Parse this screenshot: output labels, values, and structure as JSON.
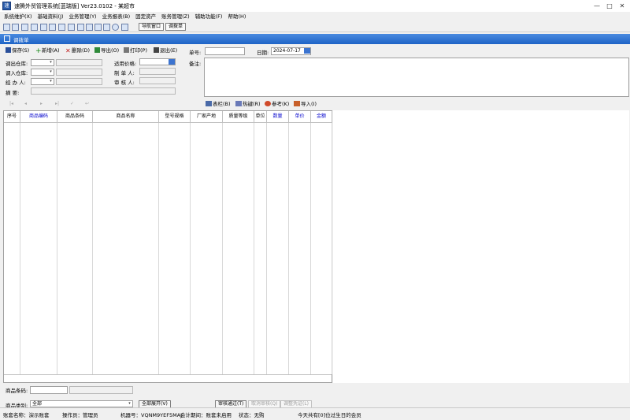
{
  "window": {
    "title": "速腾外贸管理系统[蓝瑞版] Ver23.0102 - 某超市",
    "controls": [
      "—",
      "□",
      "✕"
    ]
  },
  "menu": [
    "系统维护(X)",
    "基础资料(J)",
    "业务管理(Y)",
    "业务报表(B)",
    "固定资产",
    "账务管理(Z)",
    "辅助功能(F)",
    "帮助(H)"
  ],
  "toolbar": {
    "nav_window_label": "导航窗口",
    "transfer_label": "调拨单"
  },
  "doc": {
    "title": "调拨单"
  },
  "form_toolbar": {
    "save": "保存(S)",
    "new": "新增(A)",
    "delete": "删除(D)",
    "export": "导出(O)",
    "print": "打印(P)",
    "exit": "退出(E)",
    "doc_no_label": "单号:",
    "doc_no_value": "",
    "date_label": "日期:",
    "date_value": "2024-07-17"
  },
  "form": {
    "out_wh_label": "调出仓库:",
    "in_wh_label": "调入仓库:",
    "handler_label": "经 办 人:",
    "summary_label": "摘    要:",
    "price_label": "适用价格:",
    "maker_label": "制 单 人:",
    "auditor_label": "审 核 人:",
    "notes_label": "备注:"
  },
  "grid_toolbar": {
    "columns": "表栏(B)",
    "hotkey": "热键(R)",
    "reference": "参考(K)",
    "import": "导入(I)"
  },
  "grid": {
    "columns": [
      {
        "label": "序号",
        "color": "#000000"
      },
      {
        "label": "商品编码",
        "color": "#0000cc"
      },
      {
        "label": "商品条码",
        "color": "#000000"
      },
      {
        "label": "商品名称",
        "color": "#000000"
      },
      {
        "label": "型号规格",
        "color": "#000000"
      },
      {
        "label": "厂家产地",
        "color": "#000000"
      },
      {
        "label": "质量等级",
        "color": "#000000"
      },
      {
        "label": "单位",
        "color": "#000000"
      },
      {
        "label": "数量",
        "color": "#0000cc"
      },
      {
        "label": "单价",
        "color": "#0000cc"
      },
      {
        "label": "金额",
        "color": "#0000cc"
      }
    ]
  },
  "bottom": {
    "barcode_label": "商品条码:",
    "category_label": "商品类别:",
    "category_value": "全部",
    "expand_all": "全部展开(V)",
    "audit_pass": "审核通过(T)",
    "reject": "取消审核(Q)",
    "voucher": "调整凭证(L)"
  },
  "status": {
    "account": "账套名称：演示账套",
    "operator": "操作员：管理员",
    "machine": "机器号：VQNM9YEF5MAJ",
    "period": "会计期间：账套未启用",
    "state": "状态：无购",
    "birthday": "今天共有[0]位过生日的会员"
  }
}
